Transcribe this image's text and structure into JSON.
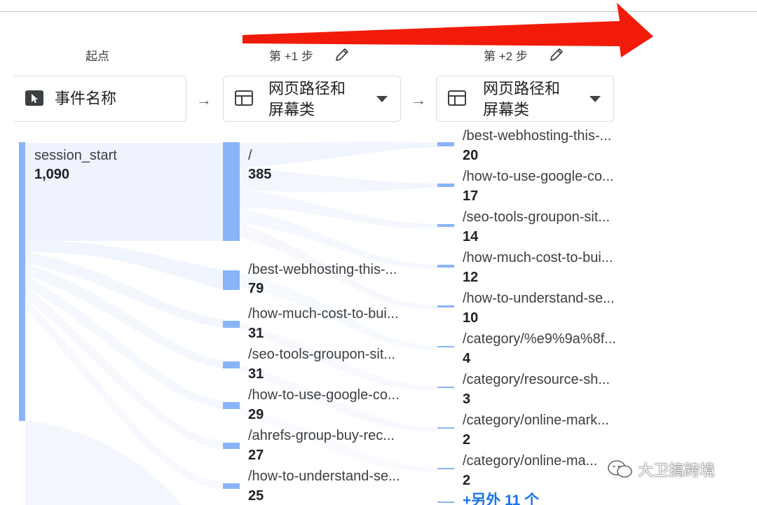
{
  "top_text": "        ",
  "columns": {
    "start": {
      "label": "起点",
      "dimension": "事件名称"
    },
    "step1": {
      "label": "第 +1 步",
      "dimension_line1": "网页路径和",
      "dimension_line2": "屏幕类"
    },
    "step2": {
      "label": "第 +2 步",
      "dimension_line1": "网页路径和",
      "dimension_line2": "屏幕类"
    }
  },
  "start_node": {
    "label": "session_start",
    "value": "1,090"
  },
  "step1_nodes": [
    {
      "label": "/",
      "value": "385"
    },
    {
      "label": "/best-webhosting-this-...",
      "value": "79"
    },
    {
      "label": "/how-much-cost-to-bui...",
      "value": "31"
    },
    {
      "label": "/seo-tools-groupon-sit...",
      "value": "31"
    },
    {
      "label": "/how-to-use-google-co...",
      "value": "29"
    },
    {
      "label": "/ahrefs-group-buy-rec...",
      "value": "27"
    },
    {
      "label": "/how-to-understand-se...",
      "value": "25"
    }
  ],
  "step2_nodes": [
    {
      "label": "/best-webhosting-this-...",
      "value": "20"
    },
    {
      "label": "/how-to-use-google-co...",
      "value": "17"
    },
    {
      "label": "/seo-tools-groupon-sit...",
      "value": "14"
    },
    {
      "label": "/how-much-cost-to-bui...",
      "value": "12"
    },
    {
      "label": "/how-to-understand-se...",
      "value": "10"
    },
    {
      "label": "/category/%e9%9a%8f...",
      "value": "4"
    },
    {
      "label": "/category/resource-sh...",
      "value": "3"
    },
    {
      "label": "/category/online-mark...",
      "value": "2"
    },
    {
      "label": "/category/online-ma...",
      "value": "2"
    }
  ],
  "more_link": "+另外 11 个",
  "watermark": "大卫搞跨境",
  "colors": {
    "bar": "#8ab4f8",
    "flow": "#e8f0fe",
    "arrow": "#f21b0a",
    "link": "#1a73e8"
  }
}
